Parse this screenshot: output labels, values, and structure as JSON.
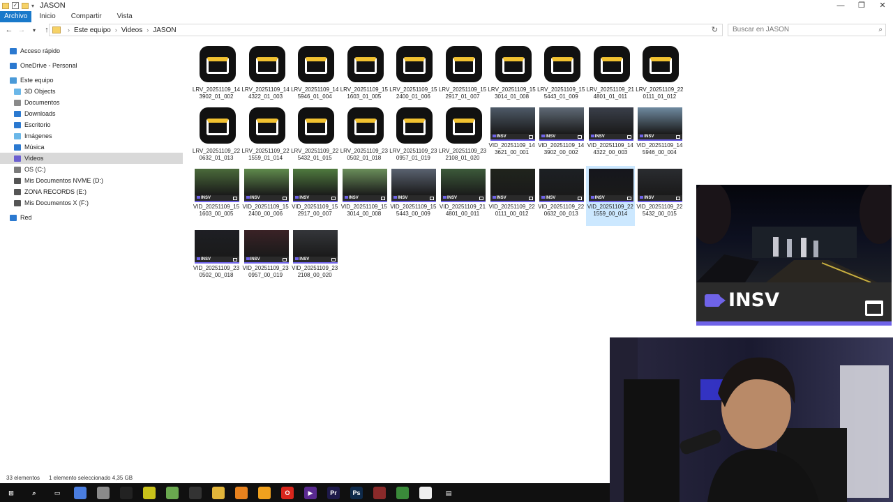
{
  "window": {
    "title": "JASON",
    "controls": [
      "—",
      "❐",
      "✕"
    ]
  },
  "ribbon": {
    "tabs": [
      "Archivo",
      "Inicio",
      "Compartir",
      "Vista"
    ]
  },
  "address": {
    "crumbs": [
      "Este equipo",
      "Videos",
      "JASON"
    ],
    "search_placeholder": "Buscar en JASON"
  },
  "sidebar": {
    "items": [
      {
        "label": "Acceso rápido",
        "icon": "star-icon",
        "color": "#2b79d0"
      },
      {
        "label": "OneDrive - Personal",
        "icon": "cloud-icon",
        "color": "#2b79d0"
      },
      {
        "label": "Este equipo",
        "icon": "computer-icon",
        "color": "#4a9ad8"
      },
      {
        "label": "3D Objects",
        "icon": "cube-icon",
        "color": "#6bb7e8"
      },
      {
        "label": "Documentos",
        "icon": "document-icon",
        "color": "#8a8a8a"
      },
      {
        "label": "Downloads",
        "icon": "download-icon",
        "color": "#2b79d0"
      },
      {
        "label": "Escritorio",
        "icon": "desktop-icon",
        "color": "#2b79d0"
      },
      {
        "label": "Imágenes",
        "icon": "image-icon",
        "color": "#6bb7e8"
      },
      {
        "label": "Música",
        "icon": "music-icon",
        "color": "#2b79d0"
      },
      {
        "label": "Videos",
        "icon": "video-icon",
        "color": "#6b5fd0"
      },
      {
        "label": "OS (C:)",
        "icon": "drive-icon",
        "color": "#7a7a7a"
      },
      {
        "label": "Mis Documentos NVME (D:)",
        "icon": "drive-icon",
        "color": "#555555"
      },
      {
        "label": "ZONA RECORDS (E:)",
        "icon": "drive-icon",
        "color": "#555555"
      },
      {
        "label": "Mis Documentos X (F:)",
        "icon": "drive-icon",
        "color": "#555555"
      },
      {
        "label": "Red",
        "icon": "network-icon",
        "color": "#2b79d0"
      }
    ]
  },
  "files": {
    "lrv": [
      [
        "LRV_20251109_14",
        "3902_01_002"
      ],
      [
        "LRV_20251109_14",
        "4322_01_003"
      ],
      [
        "LRV_20251109_14",
        "5946_01_004"
      ],
      [
        "LRV_20251109_15",
        "1603_01_005"
      ],
      [
        "LRV_20251109_15",
        "2400_01_006"
      ],
      [
        "LRV_20251109_15",
        "2917_01_007"
      ],
      [
        "LRV_20251109_15",
        "3014_01_008"
      ],
      [
        "LRV_20251109_15",
        "5443_01_009"
      ],
      [
        "LRV_20251109_21",
        "4801_01_011"
      ],
      [
        "LRV_20251109_22",
        "0111_01_012"
      ],
      [
        "LRV_20251109_22",
        "0632_01_013"
      ],
      [
        "LRV_20251109_22",
        "1559_01_014"
      ],
      [
        "LRV_20251109_22",
        "5432_01_015"
      ],
      [
        "LRV_20251109_23",
        "0502_01_018"
      ],
      [
        "LRV_20251109_23",
        "0957_01_019"
      ],
      [
        "LRV_20251109_23",
        "2108_01_020"
      ]
    ],
    "vid": [
      {
        "l1": "VID_20251109_14",
        "l2": "3621_00_001",
        "color": "#4e5a68"
      },
      {
        "l1": "VID_20251109_14",
        "l2": "3902_00_002",
        "color": "#5f6a76"
      },
      {
        "l1": "VID_20251109_14",
        "l2": "4322_00_003",
        "color": "#3a3f4a"
      },
      {
        "l1": "VID_20251109_14",
        "l2": "5946_00_004",
        "color": "#6f8aa0"
      },
      {
        "l1": "VID_20251109_15",
        "l2": "1603_00_005",
        "color": "#4a6a3a"
      },
      {
        "l1": "VID_20251109_15",
        "l2": "2400_00_006",
        "color": "#5f8a4c"
      },
      {
        "l1": "VID_20251109_15",
        "l2": "2917_00_007",
        "color": "#4f7a3e"
      },
      {
        "l1": "VID_20251109_15",
        "l2": "3014_00_008",
        "color": "#6a8e5a"
      },
      {
        "l1": "VID_20251109_15",
        "l2": "5443_00_009",
        "color": "#5a6270"
      },
      {
        "l1": "VID_20251109_21",
        "l2": "4801_00_011",
        "color": "#3c5a3a"
      },
      {
        "l1": "VID_20251109_22",
        "l2": "0111_00_012",
        "color": "#20241c"
      },
      {
        "l1": "VID_20251109_22",
        "l2": "0632_00_013",
        "color": "#1c2024"
      },
      {
        "l1": "VID_20251109_22",
        "l2": "1559_00_014",
        "color": "#15161c"
      },
      {
        "l1": "VID_20251109_22",
        "l2": "5432_00_015",
        "color": "#2a2c30"
      },
      {
        "l1": "VID_20251109_23",
        "l2": "0502_00_018",
        "color": "#1e1f24"
      },
      {
        "l1": "VID_20251109_23",
        "l2": "0957_00_019",
        "color": "#3a2226"
      },
      {
        "l1": "VID_20251109_23",
        "l2": "2108_00_020",
        "color": "#34363a"
      }
    ],
    "badge": "INSV",
    "selected_vid_index": 12
  },
  "preview": {
    "label": "INSV"
  },
  "status": {
    "count": "33 elementos",
    "selection": "1 elemento seleccionado  4,35 GB"
  },
  "taskbar": {
    "icons": [
      {
        "name": "start-icon",
        "color": "#101010",
        "glyph": "⊞"
      },
      {
        "name": "search-icon",
        "color": "#101010",
        "glyph": "⌕"
      },
      {
        "name": "task-view-icon",
        "color": "#101010",
        "glyph": "▭"
      },
      {
        "name": "copilot-icon",
        "color": "#4a7de0",
        "glyph": ""
      },
      {
        "name": "app-gray-icon",
        "color": "#8a8a8a",
        "glyph": ""
      },
      {
        "name": "capcut-icon",
        "color": "#222222",
        "glyph": ""
      },
      {
        "name": "yellow-app-icon",
        "color": "#c9c21a",
        "glyph": ""
      },
      {
        "name": "green-app-icon",
        "color": "#6aa84f",
        "glyph": ""
      },
      {
        "name": "clock-app-icon",
        "color": "#333333",
        "glyph": ""
      },
      {
        "name": "file-explorer-icon",
        "color": "#e2b53a",
        "glyph": ""
      },
      {
        "name": "vlc-icon",
        "color": "#e8821e",
        "glyph": ""
      },
      {
        "name": "chrome-icon",
        "color": "#f0a11e",
        "glyph": ""
      },
      {
        "name": "opera-icon",
        "color": "#d9261c",
        "glyph": "O"
      },
      {
        "name": "vegas-icon",
        "color": "#5a2a90",
        "glyph": "▶"
      },
      {
        "name": "premiere-icon",
        "color": "#1e1a4a",
        "glyph": "Pr"
      },
      {
        "name": "photoshop-icon",
        "color": "#0f2a4a",
        "glyph": "Ps"
      },
      {
        "name": "red-app-icon",
        "color": "#8a2a2a",
        "glyph": ""
      },
      {
        "name": "layers-app-icon",
        "color": "#3a8a3a",
        "glyph": ""
      },
      {
        "name": "capcut-2-icon",
        "color": "#eeeeee",
        "glyph": ""
      },
      {
        "name": "insta360-icon",
        "color": "#101010",
        "glyph": "▤"
      }
    ]
  }
}
